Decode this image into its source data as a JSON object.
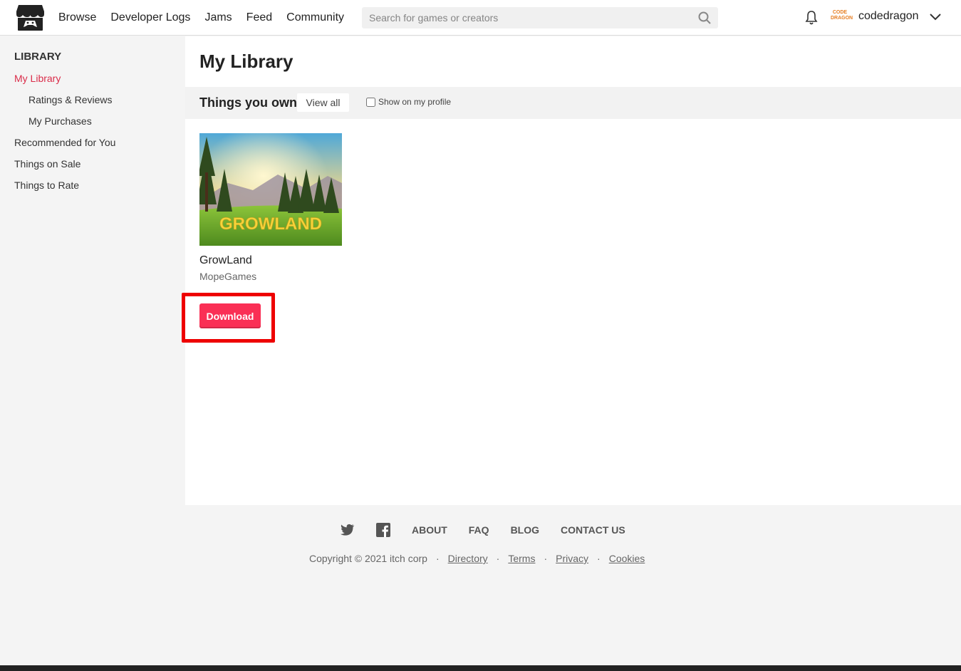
{
  "header": {
    "nav": [
      "Browse",
      "Developer Logs",
      "Jams",
      "Feed",
      "Community"
    ],
    "search_placeholder": "Search for games or creators",
    "avatar_text": "CODE DRAGON",
    "username": "codedragon"
  },
  "sidebar": {
    "heading": "LIBRARY",
    "items": [
      {
        "label": "My Library",
        "active": true
      },
      {
        "label": "Ratings & Reviews",
        "indent": true
      },
      {
        "label": "My Purchases",
        "indent": true
      },
      {
        "label": "Recommended for You"
      },
      {
        "label": "Things on Sale"
      },
      {
        "label": "Things to Rate"
      }
    ]
  },
  "main": {
    "title": "My Library",
    "section_title": "Things you own",
    "view_all": "View all",
    "show_on_profile": "Show on my profile",
    "game": {
      "thumb_text": "GROWLAND",
      "title": "GrowLand",
      "author": "MopeGames",
      "download_label": "Download"
    }
  },
  "footer": {
    "links": [
      "ABOUT",
      "FAQ",
      "BLOG",
      "CONTACT US"
    ],
    "copyright": "Copyright © 2021 itch corp",
    "legal_links": [
      "Directory",
      "Terms",
      "Privacy",
      "Cookies"
    ]
  },
  "colors": {
    "accent_red": "#da2c49",
    "download_bg": "#fa2f55",
    "highlight": "#ee0000"
  }
}
